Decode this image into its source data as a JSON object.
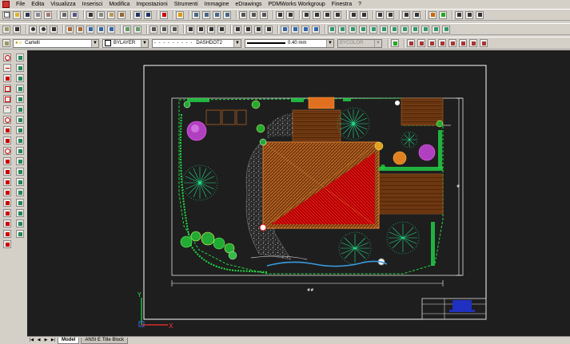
{
  "menu": [
    "File",
    "Edita",
    "Visualizza",
    "Inserisci",
    "Modifica",
    "Impostazioni",
    "Strumenti",
    "Immagine",
    "eDrawings",
    "PDMWorks Workgroup",
    "Finestra",
    "?"
  ],
  "layer_combo": "Cartelli",
  "color_combo": "BYLAYER",
  "linetype_combo": "DASHDOT2",
  "lineweight_combo": "0.40 mm",
  "plotstyle_combo": "BYCOLOR",
  "dimensions": {
    "horizontal": "##",
    "vertical": "#"
  },
  "ucs": {
    "x_label": "X",
    "y_label": "Y"
  },
  "tabs": {
    "model": "Model",
    "layout": "ANSI E Title Block"
  },
  "colors": {
    "canvas": "#1e1e1e",
    "building_orange": "#b4641e",
    "building_red": "#c80000",
    "vegetation": "#22dd44",
    "deck": "#8a4a1a"
  }
}
